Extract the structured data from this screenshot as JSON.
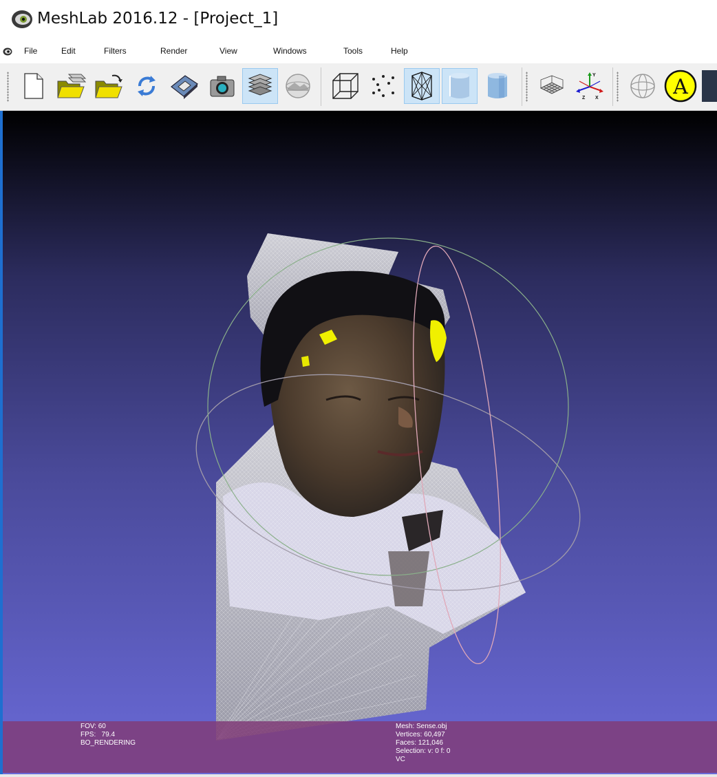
{
  "window": {
    "title": "MeshLab 2016.12 - [Project_1]"
  },
  "menu": {
    "items": [
      "File",
      "Edit",
      "Filters",
      "Render",
      "View",
      "Windows",
      "Tools",
      "Help"
    ]
  },
  "toolbar": {
    "buttons": [
      "new-document-icon",
      "open-layers-icon",
      "open-folder-icon",
      "reload-icon",
      "save-icon",
      "snapshot-camera-icon",
      "layers-icon",
      "raster-layers-icon",
      "bounding-box-icon",
      "points-icon",
      "wireframe-icon",
      "flat-shading-icon",
      "smooth-shading-icon",
      "grid-icon",
      "axes-icon",
      "trackball-icon",
      "annotation-a-icon"
    ],
    "annotation_letter": "A",
    "axes_labels": {
      "x": "X",
      "y": "Y",
      "z": "Z"
    },
    "accent": "#cce4f7"
  },
  "viewport": {
    "info_left": [
      "FOV: 60",
      "FPS:   79.4",
      "BO_RENDERING"
    ],
    "info_right": [
      "Mesh: Sense.obj",
      "Vertices: 60,497",
      "Faces: 121,046",
      "Selection: v: 0 f: 0",
      "VC"
    ],
    "infobar_color": "#803c78"
  }
}
